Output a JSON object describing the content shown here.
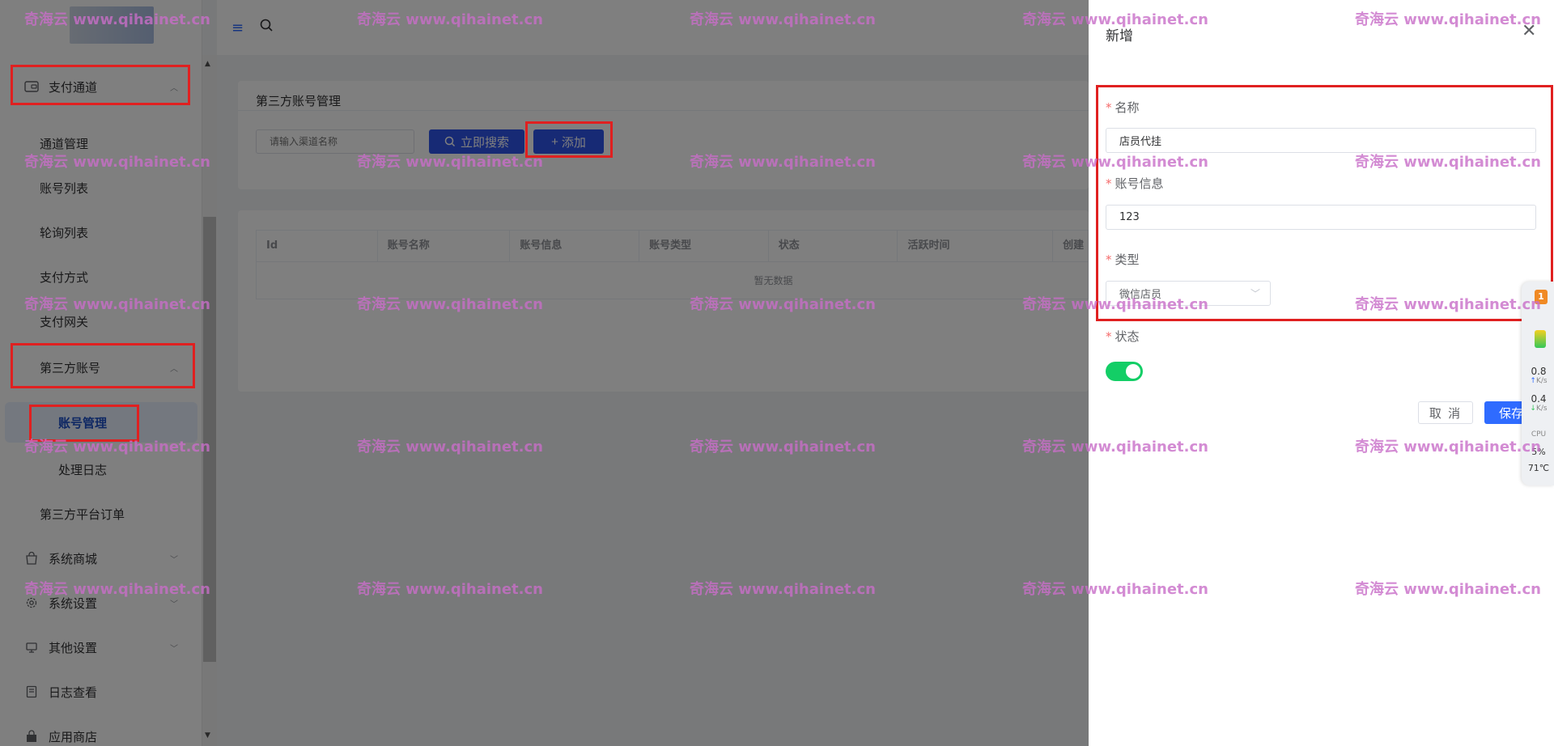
{
  "sidebar": {
    "menu": [
      {
        "label": "支付通道",
        "icon": "payment-channel-icon"
      },
      {
        "label": "系统商城",
        "icon": "shopping-bag-icon"
      },
      {
        "label": "系统设置",
        "icon": "gear-icon"
      },
      {
        "label": "其他设置",
        "icon": "settings-box-icon"
      },
      {
        "label": "日志查看",
        "icon": "log-file-icon"
      },
      {
        "label": "应用商店",
        "icon": "store-bag-icon"
      }
    ],
    "payment_sub": [
      "通道管理",
      "账号列表",
      "轮询列表",
      "支付方式",
      "支付网关"
    ],
    "third_party_group": "第三方账号",
    "third_party_sub": [
      "账号管理",
      "处理日志"
    ],
    "third_party_orders": "第三方平台订单"
  },
  "main": {
    "card_title": "第三方账号管理",
    "channel_search_placeholder": "请输入渠道名称",
    "search_button": "立即搜索",
    "add_button": "添加",
    "table": {
      "headers": [
        "Id",
        "账号名称",
        "账号信息",
        "账号类型",
        "状态",
        "活跃时间",
        "创建"
      ],
      "empty_text": "暂无数据"
    }
  },
  "drawer": {
    "title": "新增",
    "fields": {
      "name_label": "名称",
      "name_value": "店员代挂",
      "account_info_label": "账号信息",
      "account_info_value": "123",
      "type_label": "类型",
      "type_value": "微信店员",
      "status_label": "状态",
      "status_on": true
    },
    "cancel_button": "取 消",
    "save_button": "保存"
  },
  "monitor": {
    "badge": "1",
    "upload_speed": "0.8",
    "download_speed": "0.4",
    "speed_unit": "K/s",
    "cpu_label": "CPU",
    "cpu_value": "5%",
    "temperature": "71℃"
  },
  "watermark": "奇海云 www.qihainet.cn",
  "colors": {
    "primary": "#2f54eb",
    "save_blue": "#2f6bff",
    "switch_on": "#13ce66",
    "required": "#f56c6c",
    "highlight": "#e02020",
    "watermark": "#c86ec8"
  }
}
